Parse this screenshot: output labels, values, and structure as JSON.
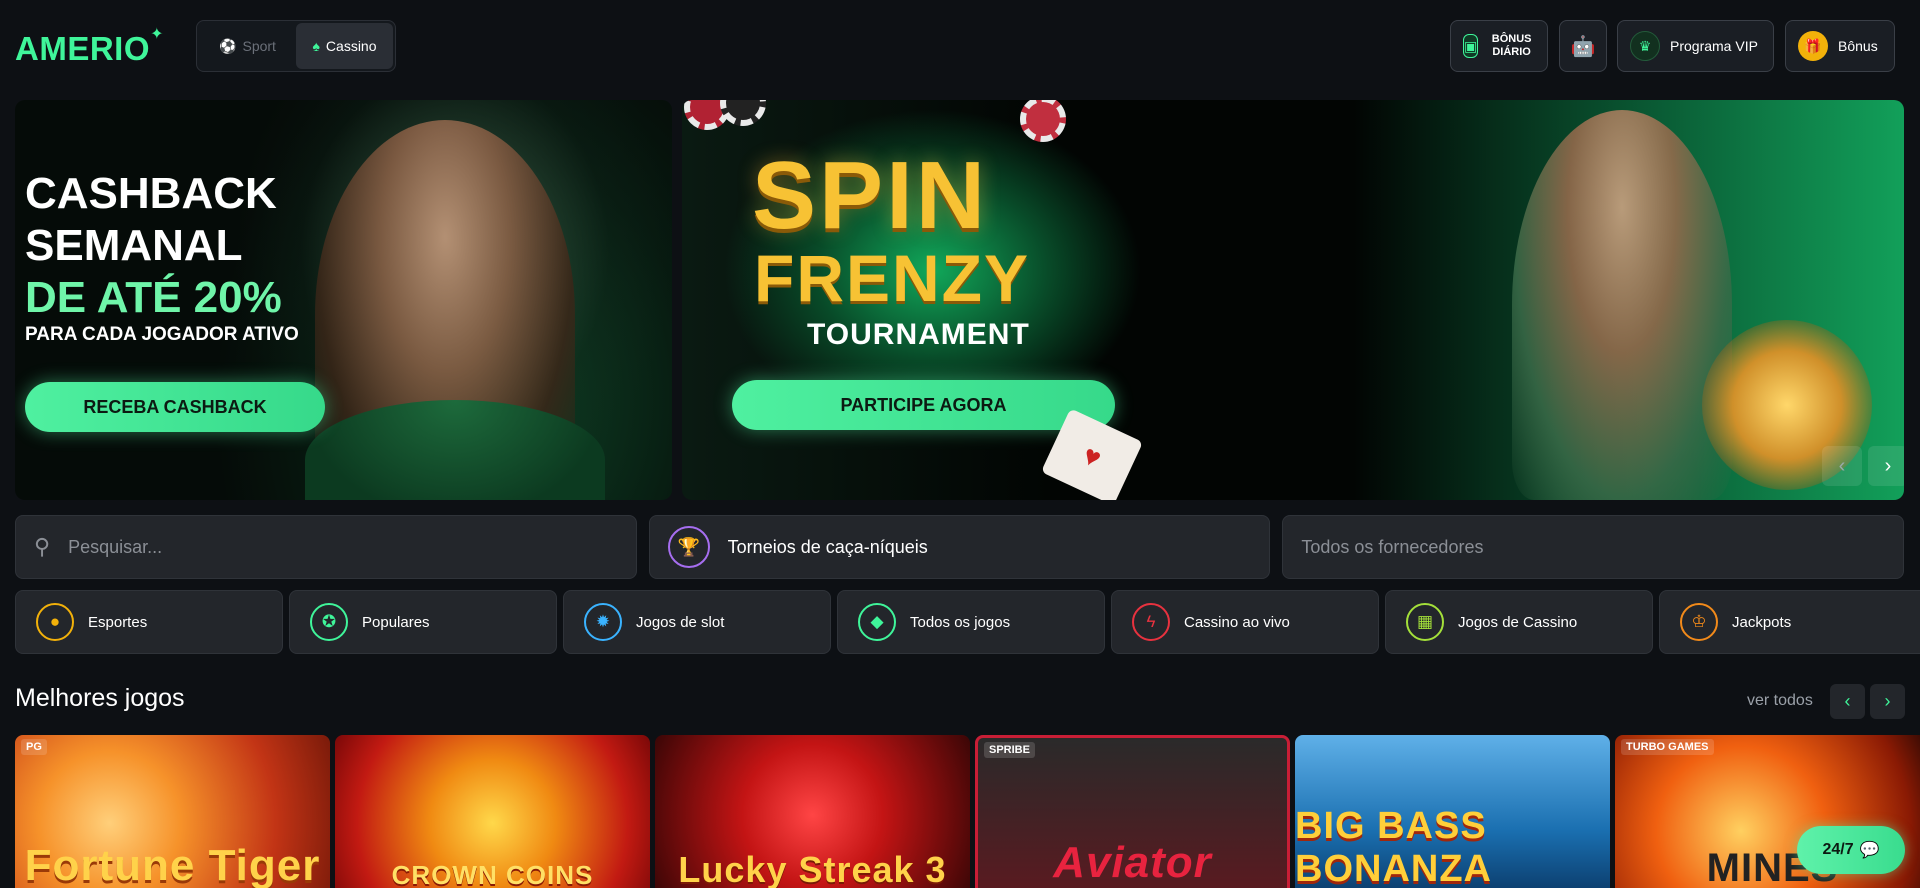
{
  "header": {
    "logo": "AMERIO",
    "modes": [
      {
        "label": "Sport",
        "icon": "ball-icon",
        "active": false
      },
      {
        "label": "Cassino",
        "icon": "spade-icon",
        "active": true
      }
    ],
    "daily_bonus_label": "BÔNUS DIÁRIO",
    "vip_label": "Programa VIP",
    "bonus_label": "Bônus"
  },
  "banners": [
    {
      "title_line1": "CASHBACK",
      "title_line2": "SEMANAL",
      "title_line3": "DE ATÉ 20%",
      "subtitle": "PARA CADA JOGADOR ATIVO",
      "cta": "RECEBA CASHBACK"
    },
    {
      "title_line1": "SPIN",
      "title_line2": "FRENZY",
      "subtitle": "TOURNAMENT",
      "cta": "PARTICIPE AGORA"
    }
  ],
  "search": {
    "placeholder": "Pesquisar...",
    "tournaments": "Torneios de caça-níqueis",
    "providers": "Todos os fornecedores"
  },
  "categories": [
    {
      "label": "Esportes",
      "icon": "ball-icon",
      "color": "#f2b10a"
    },
    {
      "label": "Populares",
      "icon": "medal-icon",
      "color": "#3ff59a"
    },
    {
      "label": "Jogos de slot",
      "icon": "gear-icon",
      "color": "#3ab3ff"
    },
    {
      "label": "Todos os jogos",
      "icon": "cards-icon",
      "color": "#3ff59a"
    },
    {
      "label": "Cassino ao vivo",
      "icon": "lightning-icon",
      "color": "#e8323f"
    },
    {
      "label": "Jogos de Cassino",
      "icon": "slot-machine-icon",
      "color": "#a4e03a"
    },
    {
      "label": "Jackpots",
      "icon": "crown-icon",
      "color": "#f28a1a"
    }
  ],
  "section": {
    "title": "Melhores jogos",
    "see_all": "ver todos"
  },
  "games": [
    {
      "name": "Fortune Tiger",
      "provider": "PG"
    },
    {
      "name": "CROWN COINS",
      "provider": ""
    },
    {
      "name": "Lucky Streak 3",
      "provider": ""
    },
    {
      "name": "Aviator",
      "provider": "SPRIBE"
    },
    {
      "name": "BIG BASS BONANZA",
      "provider": ""
    },
    {
      "name": "MINES",
      "provider": "TURBO GAMES"
    }
  ],
  "support_label": "24/7"
}
